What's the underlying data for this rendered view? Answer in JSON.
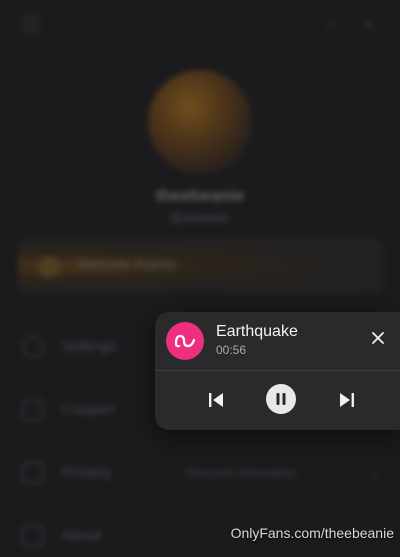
{
  "profile": {
    "username": "theebeanie",
    "user_id": "@ebeanie"
  },
  "points": {
    "label": "Remote Points"
  },
  "menu": [
    {
      "label": "Settings",
      "icon": "gear-icon"
    },
    {
      "label": "Coupon",
      "icon": "coupon-icon"
    },
    {
      "label": "Privacy",
      "icon": "lock-icon",
      "value": "Personal information",
      "chevron": "›"
    },
    {
      "label": "About",
      "icon": "info-icon"
    }
  ],
  "player": {
    "title": "Earthquake",
    "elapsed": "00:56",
    "logo_icon": "app-logo-icon",
    "close_icon": "close-icon",
    "controls": [
      "previous-icon",
      "pause-icon",
      "next-icon"
    ]
  },
  "watermark": "OnlyFans.com/theebeanie",
  "colors": {
    "accent": "#ee2f7f",
    "panel": "#2a2a2c",
    "background": "#1b1b1e"
  }
}
